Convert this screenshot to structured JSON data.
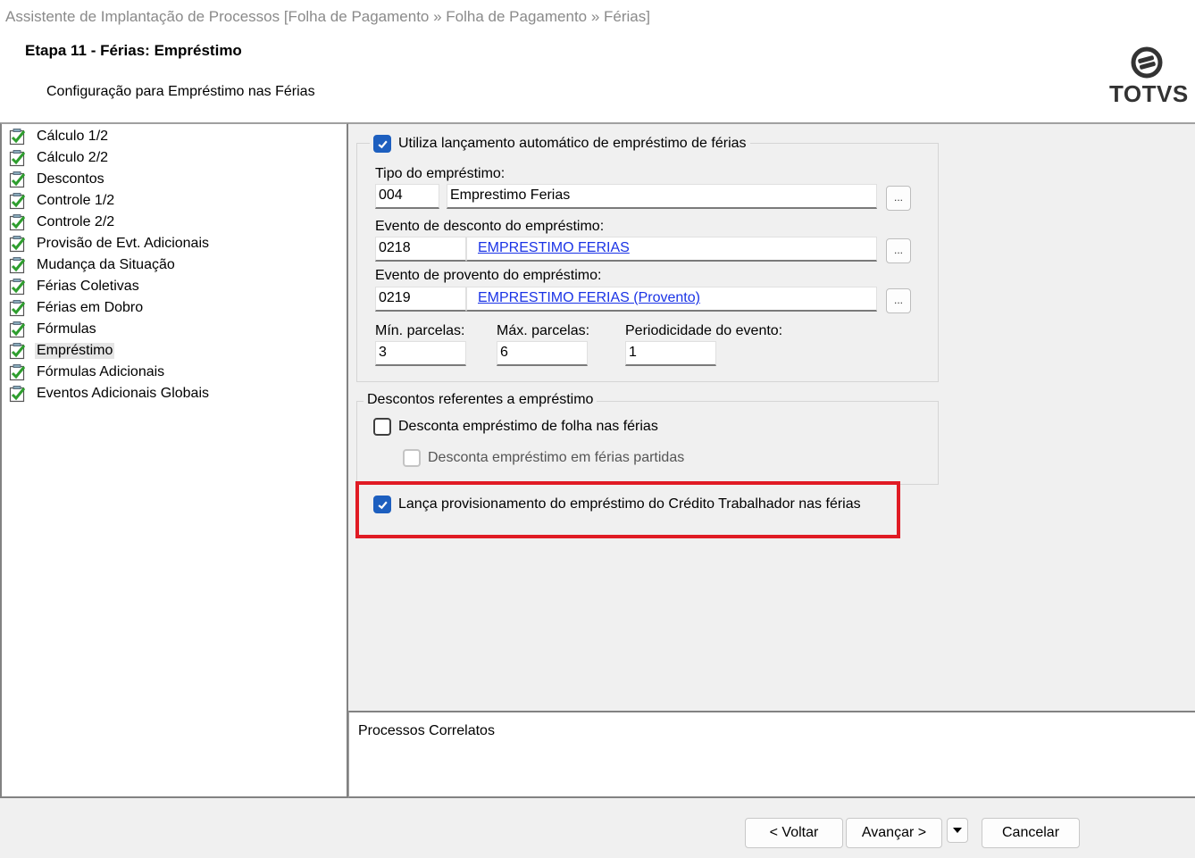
{
  "window": {
    "title": "Assistente de Implantação de Processos [Folha de Pagamento » Folha de Pagamento » Férias]"
  },
  "header": {
    "step_title": "Etapa 11 - Férias: Empréstimo",
    "step_desc": "Configuração para Empréstimo nas Férias",
    "logo": "TOTVS"
  },
  "tree": {
    "items": [
      {
        "label": "Cálculo 1/2"
      },
      {
        "label": "Cálculo 2/2"
      },
      {
        "label": "Descontos"
      },
      {
        "label": "Controle 1/2"
      },
      {
        "label": "Controle 2/2"
      },
      {
        "label": "Provisão de Evt. Adicionais"
      },
      {
        "label": "Mudança da Situação"
      },
      {
        "label": "Férias Coletivas"
      },
      {
        "label": "Férias em Dobro"
      },
      {
        "label": "Fórmulas"
      },
      {
        "label": "Empréstimo",
        "selected": true
      },
      {
        "label": "Fórmulas Adicionais"
      },
      {
        "label": "Eventos Adicionais Globais"
      }
    ]
  },
  "form": {
    "auto_loan": {
      "label": "Utiliza lançamento automático de empréstimo de férias",
      "checked": true
    },
    "tipo": {
      "label": "Tipo do empréstimo:",
      "code": "004",
      "name": "Emprestimo Ferias",
      "browse": "..."
    },
    "desconto": {
      "label": "Evento de desconto do empréstimo:",
      "code": "0218",
      "name": "EMPRESTIMO FERIAS",
      "browse": "..."
    },
    "provento": {
      "label": "Evento de provento do empréstimo:",
      "code": "0219",
      "name": "EMPRESTIMO FERIAS (Provento)",
      "browse": "..."
    },
    "min_parcelas": {
      "label": "Mín. parcelas:",
      "value": "3"
    },
    "max_parcelas": {
      "label": "Máx. parcelas:",
      "value": "6"
    },
    "periodicidade": {
      "label": "Periodicidade do evento:",
      "value": "1"
    },
    "descontos_group": {
      "legend": "Descontos referentes a empréstimo",
      "folha": {
        "label": "Desconta empréstimo de folha nas férias",
        "checked": false
      },
      "partidas": {
        "label": "Desconta empréstimo em férias partidas",
        "checked": false,
        "disabled": true
      }
    },
    "provisionamento": {
      "label": "Lança provisionamento do empréstimo do Crédito Trabalhador nas férias",
      "checked": true
    }
  },
  "correlatos": {
    "label": "Processos Correlatos"
  },
  "footer": {
    "voltar": "< Voltar",
    "avancar": "Avançar >",
    "cancelar": "Cancelar"
  },
  "colors": {
    "accent": "#1d5fbf",
    "link": "#1a33e6",
    "highlight": "#e01b24",
    "tree_check": "#2e9e2e"
  }
}
